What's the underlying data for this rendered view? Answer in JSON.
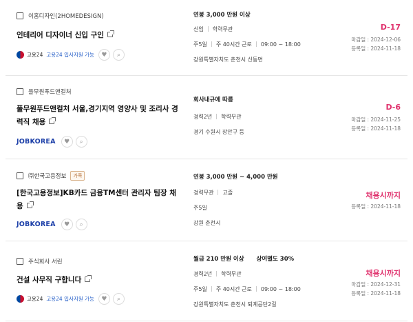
{
  "jobs": [
    {
      "company": "이홈디자인(2HOMEDESIGN)",
      "tag": "",
      "title": "인테리어 디자이너 신입 구인",
      "brand": "gov",
      "brand_text": "고용24",
      "brand_sub": "고용24 입사지원 가능",
      "salary": "연봉 3,000 만원 이상",
      "salary2": "",
      "line1": [
        "신입",
        "학력무관"
      ],
      "line2": [
        "주5일",
        "주 40시간 근로",
        "09:00 ~ 18:00"
      ],
      "location": "강원특별자치도 춘천시 신동면",
      "dday": "D-17",
      "deadline": "마감일 : 2024-12-06",
      "registered": "등록일 : 2024-11-18"
    },
    {
      "company": "풀무원푸드앤컬처",
      "tag": "",
      "title": "풀무원푸드앤컬처 서울,경기지역 영양사 및 조리사 경력직 채용",
      "brand": "jobkorea",
      "brand_text": "JOBKOREA",
      "brand_sub": "",
      "salary": "회사내규에 따름",
      "salary2": "",
      "line1": [
        "경력2년",
        "학력무관"
      ],
      "line2": [],
      "location": "경기 수원시 장안구 등",
      "dday": "D-6",
      "deadline": "마감일 : 2024-11-25",
      "registered": "등록일 : 2024-11-18"
    },
    {
      "company": "㈜한국고용정보",
      "tag": "가족",
      "title": "[한국고용정보]KB카드 금융TM센터 관리자 팀장 채용",
      "brand": "jobkorea",
      "brand_text": "JOBKOREA",
      "brand_sub": "",
      "salary": "연봉 3,000 만원 ~ 4,000 만원",
      "salary2": "",
      "line1": [
        "경력무관",
        "고졸"
      ],
      "line2": [
        "주5일"
      ],
      "location": "강원 춘천시",
      "dday": "채용시까지",
      "deadline": "",
      "registered": "등록일 : 2024-11-18"
    },
    {
      "company": "주식회사 서린",
      "tag": "",
      "title": "건설 사무직 구합니다",
      "brand": "gov",
      "brand_text": "고용24",
      "brand_sub": "고용24 입사지원 가능",
      "salary": "월급 210 만원 이상",
      "salary2": "상여별도 30%",
      "line1": [
        "경력2년",
        "학력무관"
      ],
      "line2": [
        "주5일",
        "주 40시간 근로",
        "09:00 ~ 18:00"
      ],
      "location": "강원특별자치도 춘천시 퇴계공단2길",
      "dday": "채용시까지",
      "deadline": "마감일 : 2024-12-31",
      "registered": "등록일 : 2024-11-18"
    }
  ],
  "colors": {
    "dday": "#e0336e",
    "jobkorea": "#1c3fa8",
    "gov_link": "#2a62c9"
  },
  "icons": {
    "favorite": "heart-icon",
    "search": "search-icon",
    "external": "external-link-icon",
    "checkbox": "checkbox-icon"
  }
}
